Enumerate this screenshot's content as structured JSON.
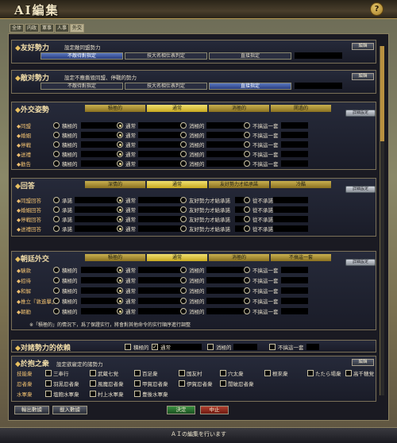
{
  "window": {
    "title": "AI編集"
  },
  "tabs": [
    "全体",
    "内政",
    "軍事",
    "人事",
    "外交"
  ],
  "friendly": {
    "title": "友好勢力",
    "desc": "設定敵同盟勢力",
    "options": [
      "不敵待對指定",
      "技大名相仕表判定",
      "直接指定"
    ],
    "edit": "編輯"
  },
  "hostile": {
    "title": "敵对勢力",
    "desc": "設定不應撕毀同盟、停戰的勢力",
    "options": [
      "不敵待對指定",
      "技大名相仕表判定",
      "直接指定"
    ],
    "edit": "編輯"
  },
  "diplomacy": {
    "title": "外交姿勢",
    "bars": [
      "積極的",
      "通常",
      "消極的",
      "関過的"
    ],
    "detail": "詳細設定",
    "rows": [
      {
        "label": "同盟",
        "sel": 1
      },
      {
        "label": "婚姻",
        "sel": 1
      },
      {
        "label": "停戦",
        "sel": 1
      },
      {
        "label": "送禮",
        "sel": 1
      },
      {
        "label": "勸告",
        "sel": 1
      }
    ],
    "opts": [
      "積極的",
      "通常",
      "消極的",
      "不搞這一套"
    ]
  },
  "reply": {
    "title": "回答",
    "bars": [
      "深情的",
      "通常",
      "友好勢力才給承諾",
      "冷酷"
    ],
    "detail": "詳細設定",
    "rows": [
      {
        "label": "同盟回答",
        "sel": 1
      },
      {
        "label": "婚姻回答",
        "sel": 1
      },
      {
        "label": "停戦回答",
        "sel": 1
      },
      {
        "label": "送禮回答",
        "sel": 1
      }
    ],
    "opts": [
      "承諾",
      "通常",
      "友好勢力才給承諾",
      "從不承諾"
    ]
  },
  "court": {
    "title": "朝廷外交",
    "bars": [
      "積極的",
      "通常",
      "消極的",
      "不搞這一套"
    ],
    "detail": "詳細設定",
    "rows": [
      {
        "label": "験款",
        "sel": 1
      },
      {
        "label": "招待",
        "sel": 1
      },
      {
        "label": "和解",
        "sel": 1
      },
      {
        "label": "推立『敦進擊』",
        "sel": 1
      },
      {
        "label": "朝勸",
        "sel": 1
      }
    ],
    "opts": [
      "積極的",
      "通常",
      "消極的",
      "不搞這一套"
    ],
    "note": "※「積極的」的情況下，爲了保證实行，將會對其他命令的实行順序進行調整"
  },
  "dependence": {
    "title": "对諸勢力的依賴",
    "opts": [
      "積極的",
      "通常",
      "消極的",
      "不搞這一套"
    ],
    "checked": [
      false,
      true,
      false,
      false
    ]
  },
  "retainers": {
    "title": "於抱之衆",
    "desc": "設定欲雇定的諸勢力",
    "edit": "編輯",
    "rows": [
      {
        "label": "技能衆",
        "items": [
          "三奉行",
          "武蔵七党",
          "百足衆",
          "国友村",
          "穴太衆",
          "根來衆",
          "たたら場衆",
          "高千穂党"
        ]
      },
      {
        "label": "忍者衆",
        "items": [
          "羽黒忍者衆",
          "風魔忍者衆",
          "甲賀忍者衆",
          "伊賀忍者衆",
          "閒破忍者衆"
        ]
      },
      {
        "label": "水軍衆",
        "items": [
          "塩飽水軍衆",
          "村上水軍衆",
          "豊後水軍衆"
        ]
      }
    ]
  },
  "buttons": {
    "export": "輸出數據",
    "import": "載入數據",
    "ok": "決定",
    "cancel": "中止"
  },
  "status": "ＡＩの編集を行います"
}
